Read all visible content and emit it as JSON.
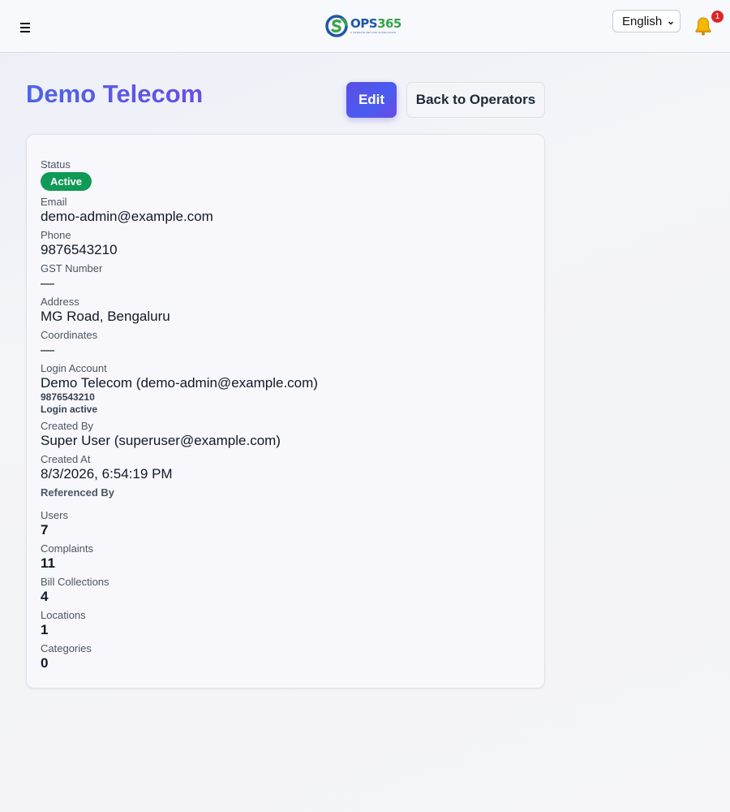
{
  "header": {
    "brand_ops": "OPS",
    "brand_num": "365",
    "brand_tagline": "A OPERATE BEYOND EXCELLENCE",
    "language": "English",
    "notification_count": "1"
  },
  "page": {
    "title": "Demo Telecom",
    "edit_label": "Edit",
    "back_label": "Back to Operators"
  },
  "details": {
    "status_label": "Status",
    "status_value": "Active",
    "email_label": "Email",
    "email_value": "demo-admin@example.com",
    "phone_label": "Phone",
    "phone_value": "9876543210",
    "gst_label": "GST Number",
    "gst_value": "—",
    "address_label": "Address",
    "address_value": "MG Road, Bengaluru",
    "coords_label": "Coordinates",
    "coords_value": "—",
    "login_label": "Login Account",
    "login_value": "Demo Telecom (demo-admin@example.com)",
    "login_phone": "9876543210",
    "login_status": "Login active",
    "created_by_label": "Created By",
    "created_by_value": "Super User (superuser@example.com)",
    "created_at_label": "Created At",
    "created_at_value": "8/3/2026, 6:54:19 PM"
  },
  "references": {
    "heading": "Referenced By",
    "items": [
      {
        "label": "Users",
        "count": "7"
      },
      {
        "label": "Complaints",
        "count": "11"
      },
      {
        "label": "Bill Collections",
        "count": "4"
      },
      {
        "label": "Locations",
        "count": "1"
      },
      {
        "label": "Categories",
        "count": "0"
      }
    ]
  },
  "colors": {
    "accent": "#4f5ce8",
    "status_active": "#0f9a55",
    "badge": "#dc2626"
  },
  "icons": [
    "menu-icon",
    "ops365-logo",
    "bell-icon",
    "chevron-down-icon"
  ]
}
